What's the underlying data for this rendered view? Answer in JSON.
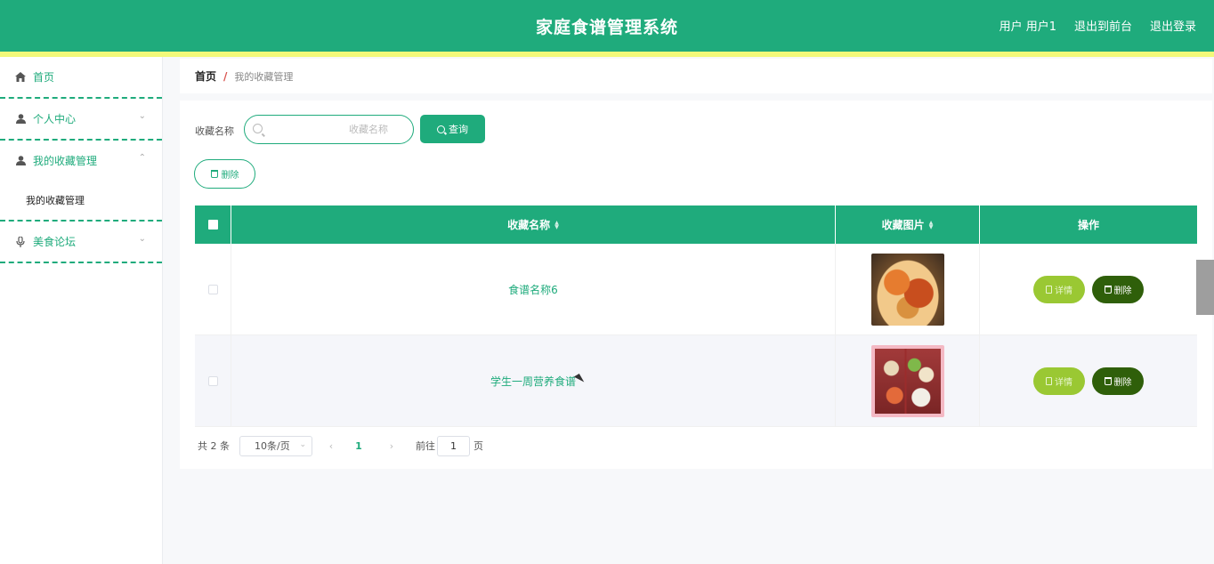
{
  "header": {
    "title": "家庭食谱管理系统",
    "user_label": "用户 用户1",
    "back_label": "退出到前台",
    "logout_label": "退出登录",
    "accent_color": "#1fab7c",
    "strip_color": "#f2f97a"
  },
  "sidebar": {
    "items": [
      {
        "label": "首页",
        "icon": "home-icon"
      },
      {
        "label": "个人中心",
        "icon": "user-icon"
      },
      {
        "label": "我的收藏管理",
        "icon": "user-icon",
        "expanded": true,
        "children": [
          "我的收藏管理"
        ]
      },
      {
        "label": "美食论坛",
        "icon": "microphone-icon"
      }
    ]
  },
  "breadcrumb": {
    "home": "首页",
    "separator": "/",
    "current": "我的收藏管理"
  },
  "search": {
    "label": "收藏名称",
    "placeholder": "收藏名称",
    "value": "",
    "query_button": "查询"
  },
  "toolbar": {
    "delete_label": "删除"
  },
  "table": {
    "columns": [
      "收藏名称",
      "收藏图片",
      "操作"
    ],
    "rows": [
      {
        "name": "食谱名称6",
        "image": "dish-photo",
        "detail": "详情",
        "delete": "删除"
      },
      {
        "name": "学生一周营养食谱",
        "image": "bento-photo",
        "detail": "详情",
        "delete": "删除"
      }
    ]
  },
  "pagination": {
    "total": "共 2 条",
    "page_size": "10条/页",
    "current_page": "1",
    "goto_label": "前往",
    "goto_value": "1",
    "page_suffix": "页"
  }
}
